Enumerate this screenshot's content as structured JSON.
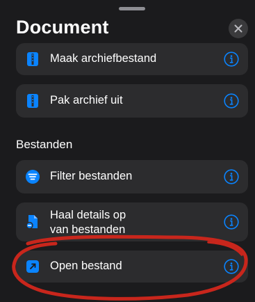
{
  "sheet": {
    "title": "Document"
  },
  "actions_top": [
    {
      "label": "Maak archiefbestand",
      "icon": "archive-icon"
    },
    {
      "label": "Pak archief uit",
      "icon": "archive-icon"
    }
  ],
  "section": {
    "header": "Bestanden"
  },
  "actions_files": [
    {
      "label": "Filter bestanden",
      "icon": "filter-list-icon"
    },
    {
      "label_line1": "Haal details op",
      "label_line2": "van bestanden",
      "icon": "file-details-icon"
    },
    {
      "label": "Open bestand",
      "icon": "open-file-icon"
    }
  ],
  "colors": {
    "background": "#1b1b1d",
    "card": "#2c2c2e",
    "accent": "#0a84ff",
    "annotation": "#c8261c"
  }
}
